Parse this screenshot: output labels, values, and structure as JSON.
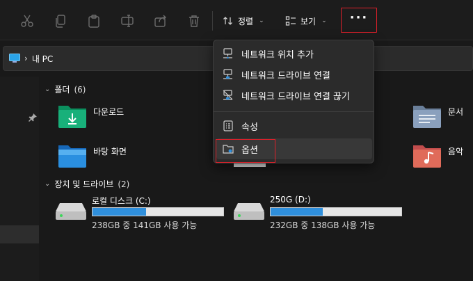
{
  "toolbar": {
    "sort_label": "정렬",
    "view_label": "보기",
    "more_label": "···"
  },
  "address": {
    "path": "내 PC"
  },
  "groups": {
    "folders": {
      "label": "폴더",
      "count": "(6)"
    },
    "drives": {
      "label": "장치 및 드라이브",
      "count": "(2)"
    }
  },
  "folders": [
    {
      "name": "다운로드",
      "icon": "download-folder-icon"
    },
    {
      "name": "바탕 화면",
      "icon": "desktop-folder-icon"
    },
    {
      "name": "문서",
      "icon": "documents-folder-icon"
    },
    {
      "name": "음악",
      "icon": "music-folder-icon"
    }
  ],
  "drives": [
    {
      "name": "로컬 디스크 (C:)",
      "info": "238GB 중 141GB 사용 가능",
      "used_fraction": 0.41
    },
    {
      "name": "250G (D:)",
      "info": "232GB 중 138GB 사용 가능",
      "used_fraction": 0.4
    }
  ],
  "menu": {
    "items": [
      {
        "label": "네트워크 위치 추가",
        "icon": "network-location-icon"
      },
      {
        "label": "네트워크 드라이브 연결",
        "icon": "map-network-drive-icon"
      },
      {
        "label": "네트워크 드라이브 연결 끊기",
        "icon": "disconnect-network-drive-icon"
      },
      {
        "label": "속성",
        "icon": "properties-icon"
      },
      {
        "label": "옵션",
        "icon": "folder-options-icon"
      }
    ]
  },
  "colors": {
    "accent": "#2f8fdc",
    "highlight_box": "#e0202a",
    "background": "#191919",
    "menu_background": "#2b2b2b"
  }
}
